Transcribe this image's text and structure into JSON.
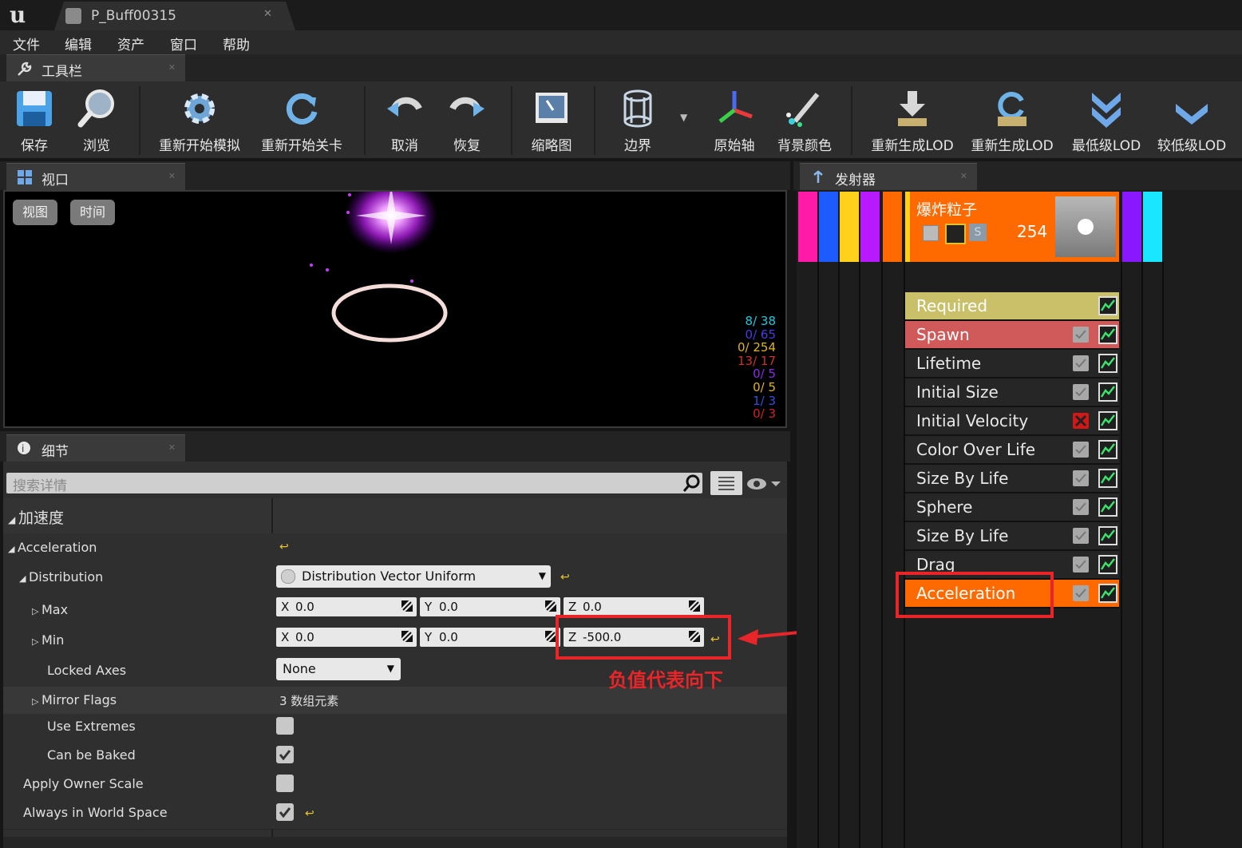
{
  "window": {
    "tab_title": "P_Buff00315"
  },
  "menu": [
    "文件",
    "编辑",
    "资产",
    "窗口",
    "帮助"
  ],
  "toolbar_panel": {
    "title": "工具栏"
  },
  "toolbar": {
    "save": "保存",
    "browse": "浏览",
    "restart_sim": "重新开始模拟",
    "restart_level": "重新开始关卡",
    "undo": "取消",
    "redo": "恢复",
    "thumbnail": "缩略图",
    "bounds": "边界",
    "origin_axis": "原始轴",
    "bg_color": "背景颜色",
    "regen_lod_1": "重新生成LOD",
    "regen_lod_2": "重新生成LOD",
    "lowest_lod": "最低级LOD",
    "lower_lod": "较低级LOD"
  },
  "viewport_panel": {
    "title": "视口",
    "view_btn": "视图",
    "time_btn": "时间"
  },
  "viewport_stats": [
    {
      "text": "8/ 38",
      "color": "#26c6e0"
    },
    {
      "text": "0/ 65",
      "color": "#4a3be0"
    },
    {
      "text": "0/ 254",
      "color": "#e0b320"
    },
    {
      "text": "13/ 17",
      "color": "#d0302a"
    },
    {
      "text": "0/  5",
      "color": "#8a2be2"
    },
    {
      "text": "0/  5",
      "color": "#e0b320"
    },
    {
      "text": "1/  3",
      "color": "#3050e0"
    },
    {
      "text": "0/  3",
      "color": "#d0202a"
    }
  ],
  "details_panel": {
    "title": "细节",
    "search_placeholder": "搜索详情",
    "category": "加速度",
    "rows": {
      "acceleration": "Acceleration",
      "distribution": "Distribution",
      "distribution_value": "Distribution Vector Uniform",
      "max": "Max",
      "min": "Min",
      "locked_axes": "Locked Axes",
      "locked_axes_value": "None",
      "mirror_flags": "Mirror Flags",
      "mirror_flags_value": "3 数组元素",
      "use_extremes": "Use Extremes",
      "can_be_baked": "Can be Baked",
      "apply_owner_scale": "Apply Owner Scale",
      "always_world_space": "Always in World Space"
    },
    "max_vec": {
      "x": "0.0",
      "y": "0.0",
      "z": "0.0"
    },
    "min_vec": {
      "x": "0.0",
      "y": "0.0",
      "z": "-500.0"
    },
    "checks": {
      "use_extremes": false,
      "can_be_baked": true,
      "apply_owner_scale": false,
      "always_world_space": true
    }
  },
  "annotation": {
    "text": "负值代表向下",
    "color": "#e8262a"
  },
  "emitter_panel": {
    "title": "发射器",
    "emitter_name": "爆炸粒子",
    "particle_count": "254",
    "strip_colors": [
      "#ff1aa8",
      "#1e5bff",
      "#ffd11a",
      "#b81aff",
      "#ff6a00"
    ],
    "right_strip_colors": [
      "#8a18ff",
      "#19e6ff"
    ],
    "modules": [
      {
        "label": "Required",
        "bg": "#c9c069",
        "fg": "#ffffff",
        "check": "none"
      },
      {
        "label": "Spawn",
        "bg": "#d05a5a",
        "fg": "#ffffff",
        "check": "box"
      },
      {
        "label": "Lifetime",
        "bg": "#262626",
        "fg": "#e8e8e8",
        "check": "box"
      },
      {
        "label": "Initial Size",
        "bg": "#262626",
        "fg": "#e8e8e8",
        "check": "box"
      },
      {
        "label": "Initial Velocity",
        "bg": "#262626",
        "fg": "#e8e8e8",
        "check": "x"
      },
      {
        "label": "Color Over Life",
        "bg": "#262626",
        "fg": "#e8e8e8",
        "check": "box"
      },
      {
        "label": "Size By Life",
        "bg": "#262626",
        "fg": "#e8e8e8",
        "check": "box"
      },
      {
        "label": "Sphere",
        "bg": "#262626",
        "fg": "#e8e8e8",
        "check": "box"
      },
      {
        "label": "Size By Life",
        "bg": "#262626",
        "fg": "#e8e8e8",
        "check": "box"
      },
      {
        "label": "Drag",
        "bg": "#262626",
        "fg": "#e8e8e8",
        "check": "box"
      },
      {
        "label": "Acceleration",
        "bg": "#ff6a00",
        "fg": "#ffffff",
        "check": "box"
      }
    ]
  }
}
